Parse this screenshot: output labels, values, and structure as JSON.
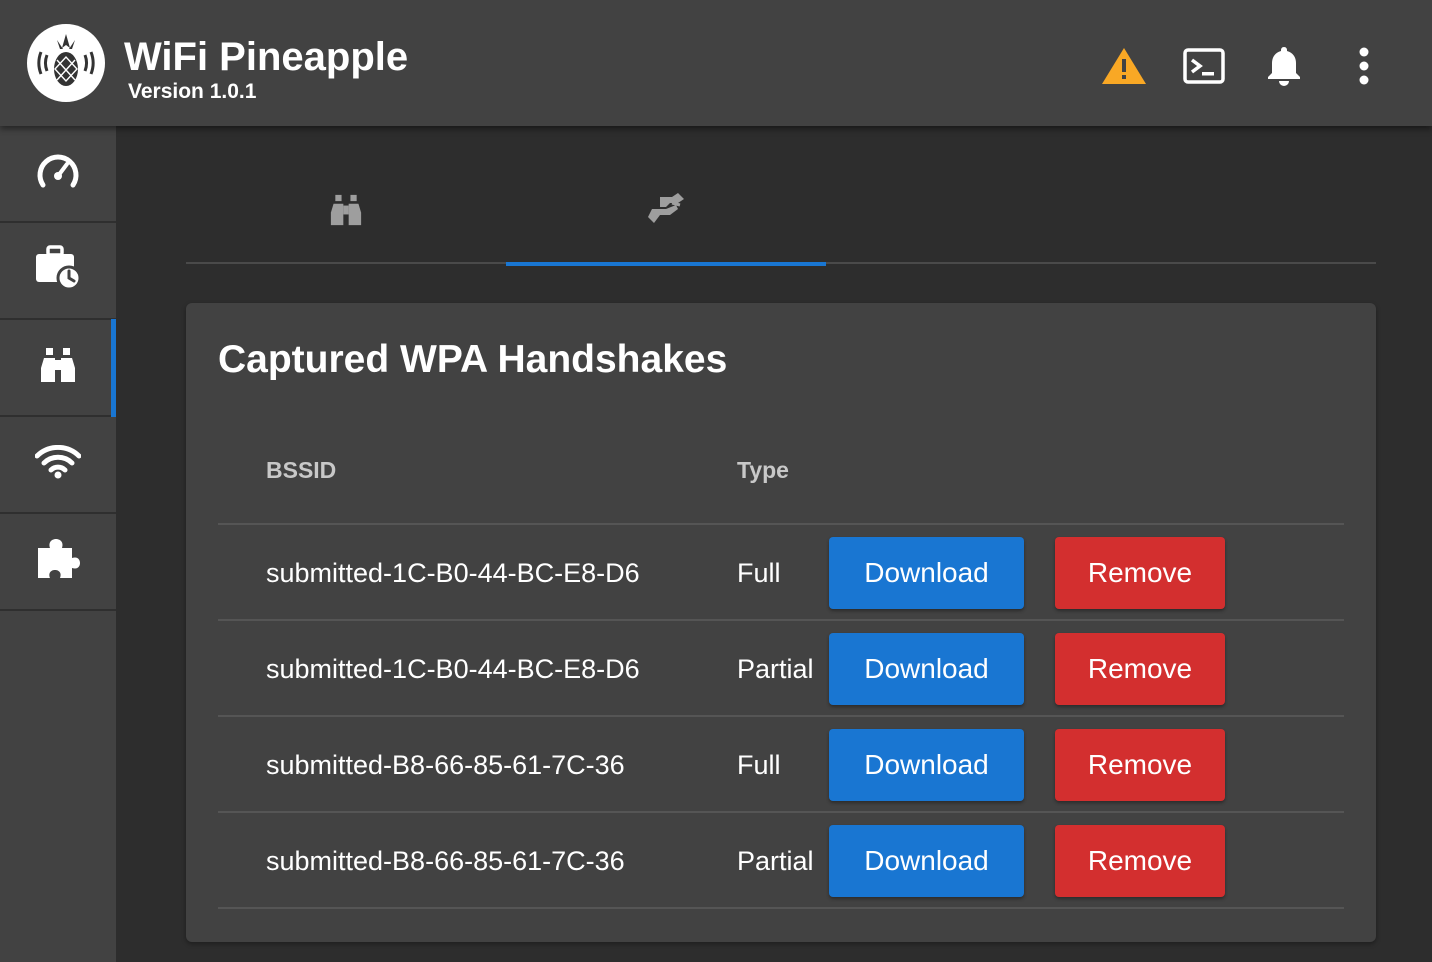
{
  "header": {
    "title": "WiFi Pineapple",
    "version": "Version 1.0.1",
    "icons": [
      "warning-icon",
      "terminal-icon",
      "bell-icon",
      "more-vertical-icon"
    ],
    "warning_color": "#f9a825"
  },
  "sidebar": {
    "items": [
      {
        "icon": "dashboard-gauge-icon",
        "active": false
      },
      {
        "icon": "campaigns-briefcase-icon",
        "active": false
      },
      {
        "icon": "recon-binoculars-icon",
        "active": true
      },
      {
        "icon": "wifi-icon",
        "active": false
      },
      {
        "icon": "modules-puzzle-icon",
        "active": false
      }
    ]
  },
  "tabs": [
    {
      "icon": "binoculars-icon",
      "active": false
    },
    {
      "icon": "handshake-icon",
      "active": true
    }
  ],
  "card": {
    "title": "Captured WPA Handshakes",
    "columns": {
      "bssid": "BSSID",
      "type": "Type"
    },
    "download_label": "Download",
    "remove_label": "Remove",
    "rows": [
      {
        "bssid": "submitted-1C-B0-44-BC-E8-D6",
        "type": "Full"
      },
      {
        "bssid": "submitted-1C-B0-44-BC-E8-D6",
        "type": "Partial"
      },
      {
        "bssid": "submitted-B8-66-85-61-7C-36",
        "type": "Full"
      },
      {
        "bssid": "submitted-B8-66-85-61-7C-36",
        "type": "Partial"
      }
    ]
  },
  "colors": {
    "primary": "#1976d2",
    "danger": "#d32f2f",
    "surface": "#424242",
    "background": "#2d2d2d"
  }
}
